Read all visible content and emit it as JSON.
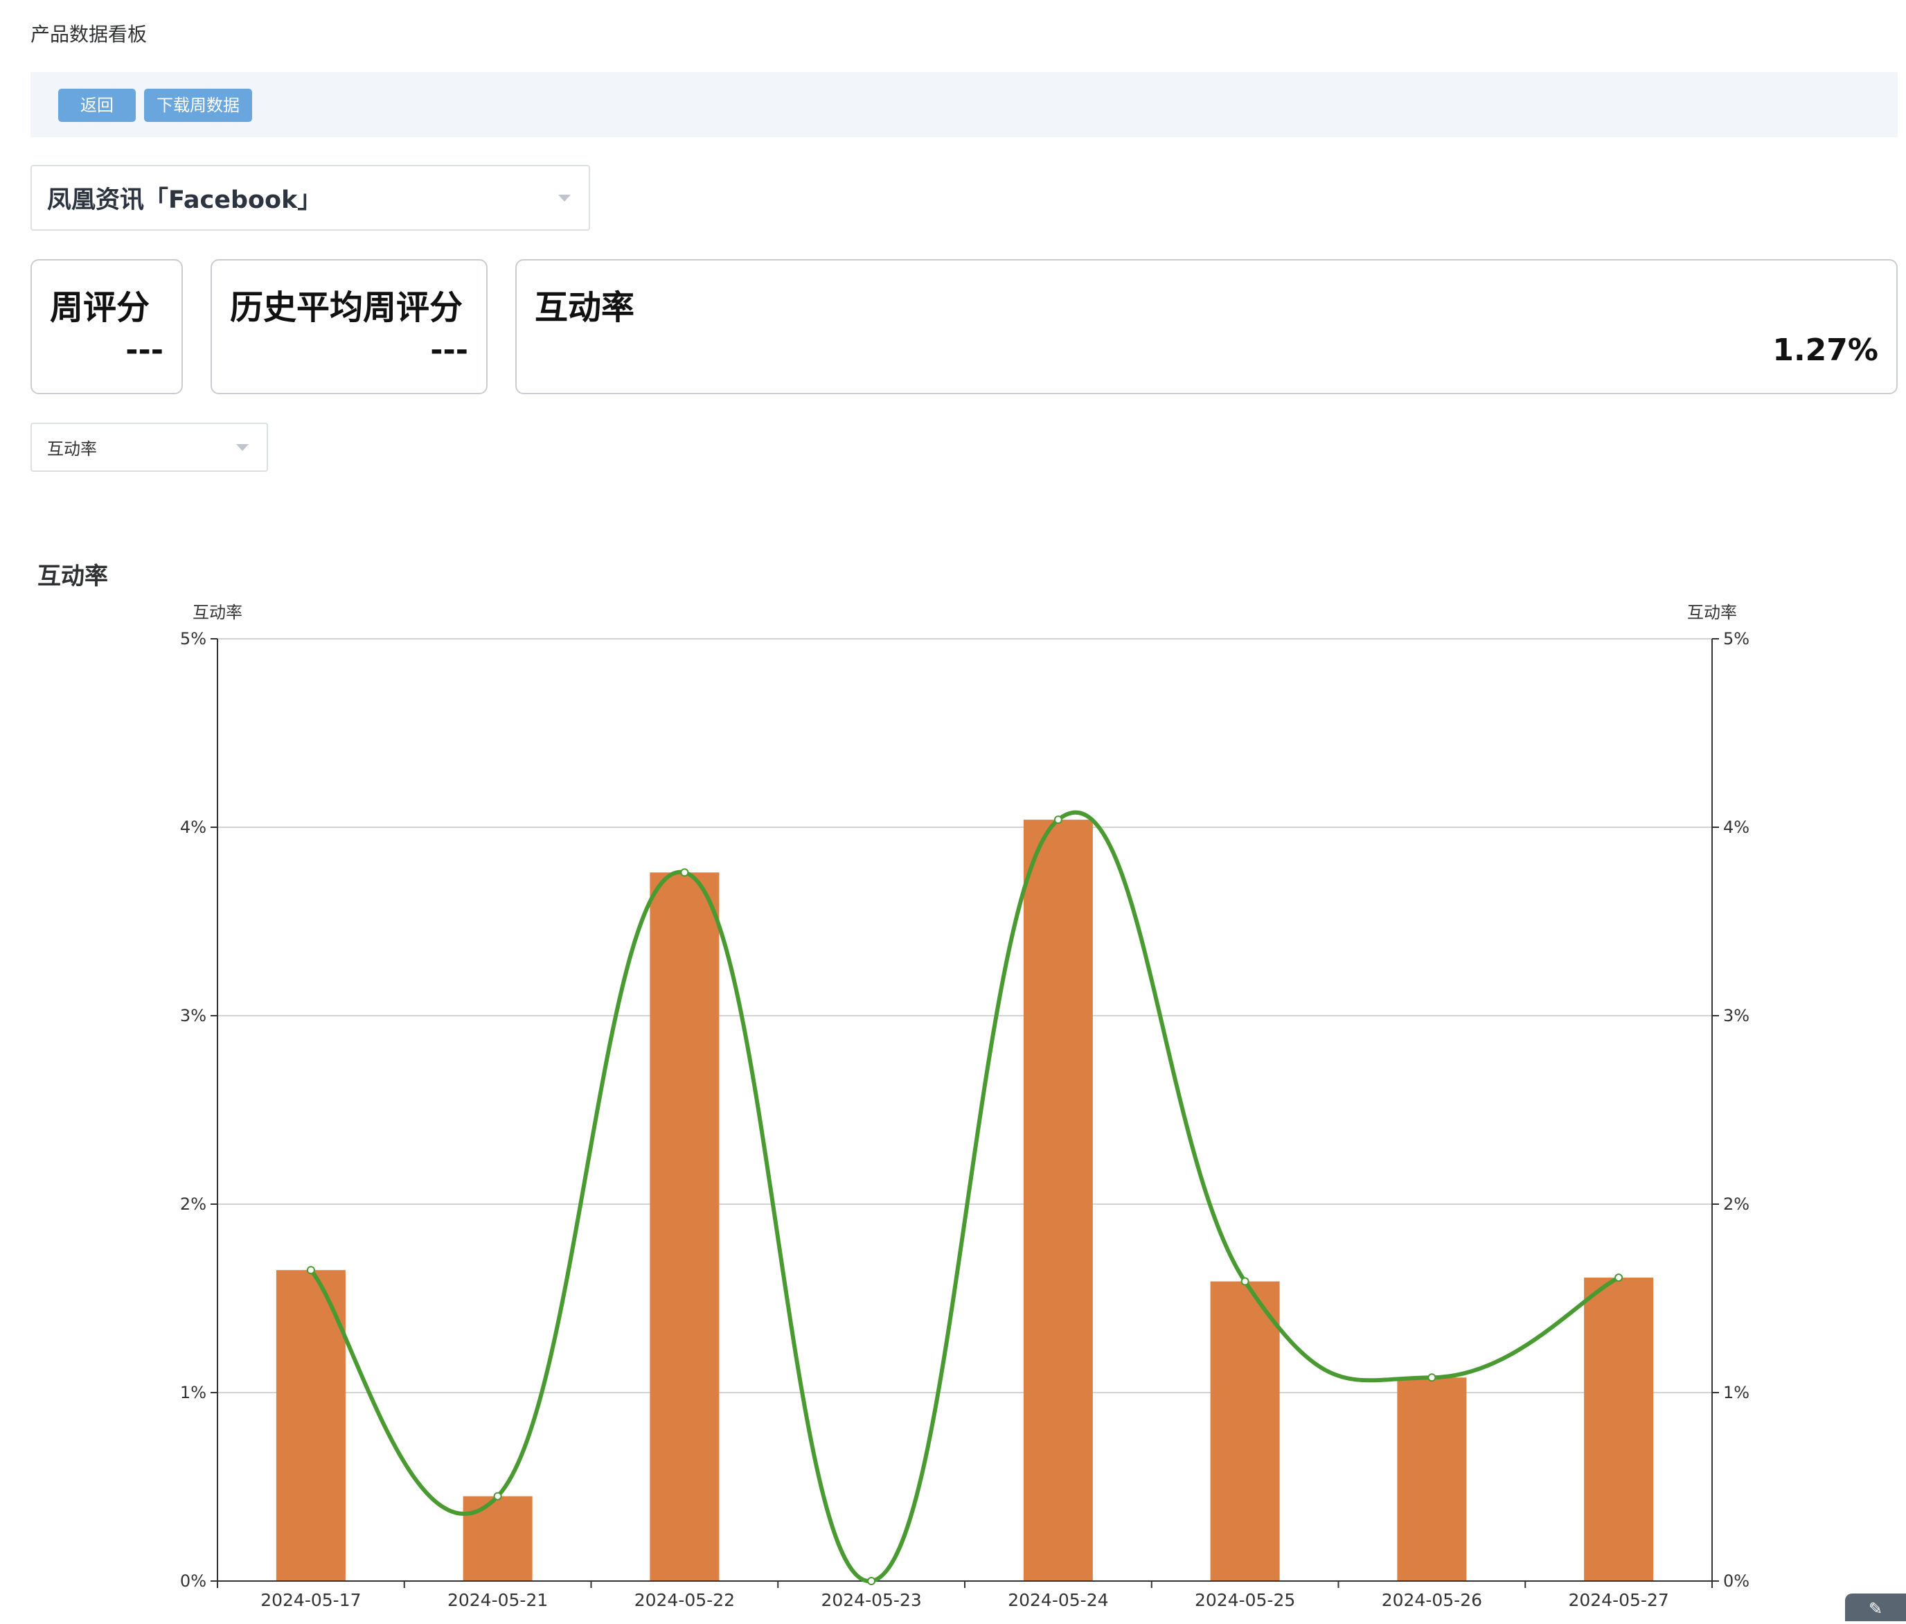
{
  "header": {
    "title": "产品数据看板"
  },
  "toolbar": {
    "back_label": "返回",
    "download_label": "下载周数据"
  },
  "product_select": {
    "value": "凤凰资讯「Facebook」"
  },
  "cards": {
    "weekly_score": {
      "label": "周评分",
      "value": "---"
    },
    "history_avg_score": {
      "label": "历史平均周评分",
      "value": "---"
    },
    "engagement_rate": {
      "label": "互动率",
      "value": "1.27%"
    }
  },
  "metric_select": {
    "value": "互动率"
  },
  "chart_section": {
    "title": "互动率"
  },
  "chart_data": {
    "type": "bar",
    "categories": [
      "2024-05-17",
      "2024-05-21",
      "2024-05-22",
      "2024-05-23",
      "2024-05-24",
      "2024-05-25",
      "2024-05-26",
      "2024-05-27"
    ],
    "series": [
      {
        "type": "bar",
        "values": [
          1.65,
          0.45,
          3.76,
          0,
          4.04,
          1.59,
          1.08,
          1.61
        ]
      },
      {
        "type": "line",
        "smooth": true,
        "values": [
          1.65,
          0.45,
          3.76,
          0,
          4.04,
          1.59,
          1.08,
          1.61
        ]
      }
    ],
    "y_left": {
      "label": "互动率",
      "ticks": [
        "0%",
        "1%",
        "2%",
        "3%",
        "4%",
        "5%"
      ],
      "range": [
        0,
        5
      ]
    },
    "y_right": {
      "label": "互动率",
      "ticks": [
        "0%",
        "1%",
        "2%",
        "3%",
        "4%",
        "5%"
      ],
      "range": [
        0,
        5
      ]
    },
    "grid": true,
    "colors": {
      "bar": "#dc7f42",
      "line": "#4a9a32",
      "grid": "#d3d3d3",
      "axis": "#333333"
    }
  },
  "corner_widget": {
    "icon": "chat-icon",
    "glyph": "✎"
  }
}
